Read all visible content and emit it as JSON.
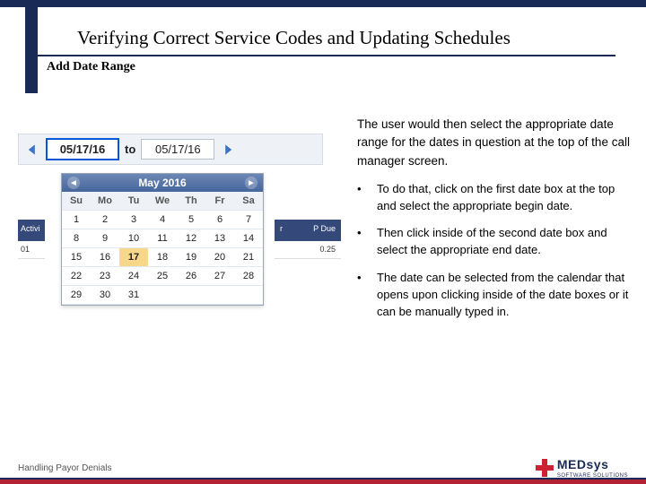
{
  "header": {
    "title": "Verifying Correct Service Codes and Updating Schedules",
    "subtitle": "Add Date Range"
  },
  "dateRange": {
    "start": "05/17/16",
    "to": "to",
    "end": "05/17/16"
  },
  "calendar": {
    "month": "May 2016",
    "dow": [
      "Su",
      "Mo",
      "Tu",
      "We",
      "Th",
      "Fr",
      "Sa"
    ],
    "rows": [
      [
        "1",
        "2",
        "3",
        "4",
        "5",
        "6",
        "7"
      ],
      [
        "8",
        "9",
        "10",
        "11",
        "12",
        "13",
        "14"
      ],
      [
        "15",
        "16",
        "17",
        "18",
        "19",
        "20",
        "21"
      ],
      [
        "22",
        "23",
        "24",
        "25",
        "26",
        "27",
        "28"
      ],
      [
        "29",
        "30",
        "31",
        "",
        "",
        "",
        ""
      ]
    ],
    "selected": "17"
  },
  "gridBehind": {
    "colA": "Activi",
    "colB_left": "r",
    "colB_right": "P Due",
    "rowA": "01",
    "rowB": "0.25"
  },
  "body": {
    "intro": "The user would then select the appropriate date range for the dates in question at the top of the call manager screen.",
    "bullets": [
      "To do that, click on the first date box at the top and select the appropriate begin date.",
      "Then click inside of the second date box and select the appropriate end date.",
      "The date can be selected from the calendar that opens upon clicking inside of the date boxes or it can be manually typed in."
    ]
  },
  "footer": {
    "left": "Handling Payor Denials",
    "brand_m": "MED",
    "brand_s": "sys",
    "brand_sub": "SOFTWARE SOLUTIONS"
  }
}
